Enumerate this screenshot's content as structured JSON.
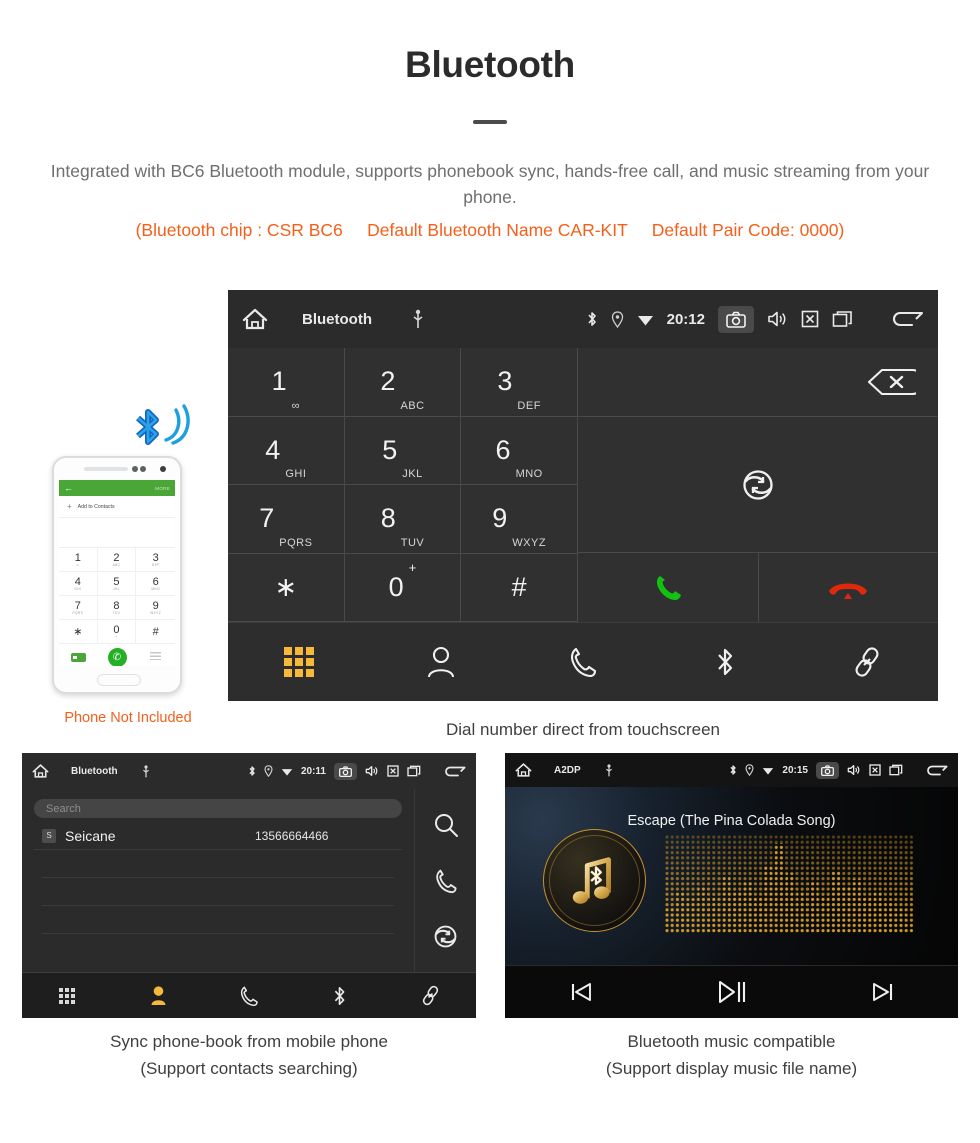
{
  "header": {
    "title": "Bluetooth",
    "subtitle": "Integrated with BC6 Bluetooth module, supports phonebook sync, hands-free call, and music streaming from your phone.",
    "specs": "(Bluetooth chip : CSR BC6     Default Bluetooth Name CAR-KIT     Default Pair Code: 0000)",
    "accent_color": "#f4601c",
    "text_color": "#6f6f6f"
  },
  "phone_mockup": {
    "header_back": "←",
    "header_more": "MORE",
    "add_contact": "Add to Contacts",
    "add_plus": "+",
    "keys": [
      {
        "digit": "1",
        "letters": "∞"
      },
      {
        "digit": "2",
        "letters": "ABC"
      },
      {
        "digit": "3",
        "letters": "DEF"
      },
      {
        "digit": "4",
        "letters": "GHI"
      },
      {
        "digit": "5",
        "letters": "JKL"
      },
      {
        "digit": "6",
        "letters": "MNO"
      },
      {
        "digit": "7",
        "letters": "PQRS"
      },
      {
        "digit": "8",
        "letters": "TUV"
      },
      {
        "digit": "9",
        "letters": "WXYZ"
      },
      {
        "digit": "∗",
        "letters": ""
      },
      {
        "digit": "0",
        "letters": "+"
      },
      {
        "digit": "#",
        "letters": ""
      }
    ],
    "call_glyph": "✆",
    "caption": "Phone Not Included",
    "caption_color": "#f4601c",
    "bt_wave_color": "#1e9fe0"
  },
  "dialer": {
    "statusbar": {
      "home_icon": "home-icon",
      "title": "Bluetooth",
      "usb_icon": "usb-icon",
      "bluetooth_icon": "bluetooth-icon",
      "location_icon": "location-icon",
      "wifi_icon": "wifi-icon",
      "time": "20:12",
      "camera_icon": "camera-icon",
      "volume_icon": "volume-icon",
      "close_icon": "close-box-icon",
      "recents_icon": "recents-icon",
      "back_icon": "back-arrow-icon"
    },
    "keys": [
      {
        "digit": "1",
        "letters": "∞",
        "sup": ""
      },
      {
        "digit": "2",
        "letters": "ABC",
        "sup": ""
      },
      {
        "digit": "3",
        "letters": "DEF",
        "sup": ""
      },
      {
        "digit": "4",
        "letters": "GHI",
        "sup": ""
      },
      {
        "digit": "5",
        "letters": "JKL",
        "sup": ""
      },
      {
        "digit": "6",
        "letters": "MNO",
        "sup": ""
      },
      {
        "digit": "7",
        "letters": "PQRS",
        "sup": ""
      },
      {
        "digit": "8",
        "letters": "TUV",
        "sup": ""
      },
      {
        "digit": "9",
        "letters": "WXYZ",
        "sup": ""
      },
      {
        "digit": "∗",
        "letters": "",
        "sup": ""
      },
      {
        "digit": "0",
        "letters": "",
        "sup": "+"
      },
      {
        "digit": "#",
        "letters": "",
        "sup": ""
      }
    ],
    "backspace_icon": "backspace-icon",
    "sync_icon": "sync-icon",
    "call_button_color": "#13c113",
    "endcall_button_color": "#e0290c",
    "tabs": [
      {
        "name": "keypad",
        "icon": "keypad-icon",
        "active": true
      },
      {
        "name": "contacts",
        "icon": "contacts-icon",
        "active": false
      },
      {
        "name": "call-log",
        "icon": "phone-icon",
        "active": false
      },
      {
        "name": "bluetooth",
        "icon": "bluetooth-icon",
        "active": false
      },
      {
        "name": "pair",
        "icon": "link-icon",
        "active": false
      }
    ],
    "active_tab_color": "#f6b93b",
    "caption": "Dial number direct from touchscreen"
  },
  "phonebook": {
    "statusbar": {
      "title": "Bluetooth",
      "time": "20:11"
    },
    "search_placeholder": "Search",
    "columns": [
      "name",
      "number"
    ],
    "contacts": [
      {
        "initial": "S",
        "name": "Seicane",
        "number": "13566664466"
      }
    ],
    "side_actions": [
      {
        "name": "search",
        "icon": "search-icon"
      },
      {
        "name": "call",
        "icon": "phone-icon"
      },
      {
        "name": "sync",
        "icon": "sync-icon"
      }
    ],
    "tabs": [
      {
        "name": "keypad",
        "icon": "keypad-icon",
        "active": false
      },
      {
        "name": "contacts",
        "icon": "contacts-icon",
        "active": true
      },
      {
        "name": "call-log",
        "icon": "phone-icon",
        "active": false
      },
      {
        "name": "bluetooth",
        "icon": "bluetooth-icon",
        "active": false
      },
      {
        "name": "pair",
        "icon": "link-icon",
        "active": false
      }
    ],
    "caption_line1": "Sync phone-book from mobile phone",
    "caption_line2": "(Support contacts searching)"
  },
  "music": {
    "statusbar": {
      "title": "A2DP",
      "time": "20:15"
    },
    "song_title": "Escape (The Pina Colada Song)",
    "album_icon": "music-note-bluetooth-icon",
    "visualizer_color": "#d39a2b",
    "controls": [
      {
        "name": "previous",
        "icon": "skip-previous-icon"
      },
      {
        "name": "play-pause",
        "icon": "play-pause-icon"
      },
      {
        "name": "next",
        "icon": "skip-next-icon"
      }
    ],
    "caption_line1": "Bluetooth music compatible",
    "caption_line2": "(Support display music file name)"
  }
}
